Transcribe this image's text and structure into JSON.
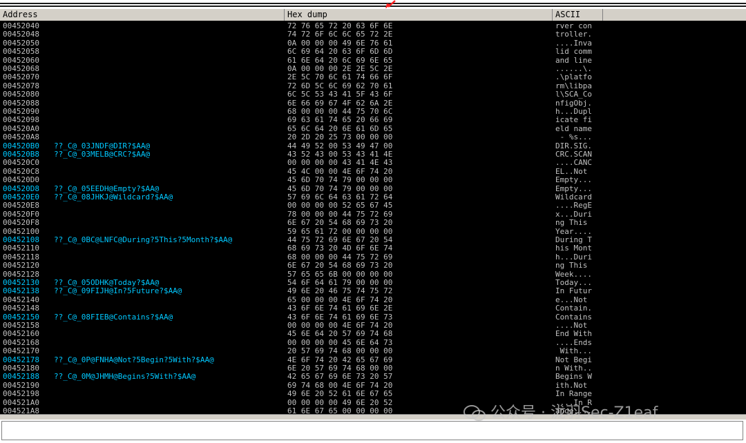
{
  "header": {
    "address": "Address",
    "hex_dump": "Hex dump",
    "ascii": "ASCII"
  },
  "rows": [
    {
      "addr": "00452040",
      "label": "",
      "hex": "72 76 65 72 20 63 6F 6E",
      "ascii": "rver con"
    },
    {
      "addr": "00452048",
      "label": "",
      "hex": "74 72 6F 6C 6C 65 72 2E",
      "ascii": "troller."
    },
    {
      "addr": "00452050",
      "label": "",
      "hex": "0A 00 00 00 49 6E 76 61",
      "ascii": "....Inva"
    },
    {
      "addr": "00452058",
      "label": "",
      "hex": "6C 69 64 20 63 6F 6D 6D",
      "ascii": "lid comm"
    },
    {
      "addr": "00452060",
      "label": "",
      "hex": "61 6E 64 20 6C 69 6E 65",
      "ascii": "and line"
    },
    {
      "addr": "00452068",
      "label": "",
      "hex": "0A 00 00 00 2E 2E 5C 2E",
      "ascii": "......\\."
    },
    {
      "addr": "00452070",
      "label": "",
      "hex": "2E 5C 70 6C 61 74 66 6F",
      "ascii": ".\\platfo"
    },
    {
      "addr": "00452078",
      "label": "",
      "hex": "72 6D 5C 6C 69 62 70 61",
      "ascii": "rm\\libpa"
    },
    {
      "addr": "00452080",
      "label": "",
      "hex": "6C 5C 53 43 41 5F 43 6F",
      "ascii": "l\\SCA_Co"
    },
    {
      "addr": "00452088",
      "label": "",
      "hex": "6E 66 69 67 4F 62 6A 2E",
      "ascii": "nfigObj."
    },
    {
      "addr": "00452090",
      "label": "",
      "hex": "68 00 00 00 44 75 70 6C",
      "ascii": "h...Dupl"
    },
    {
      "addr": "00452098",
      "label": "",
      "hex": "69 63 61 74 65 20 66 69",
      "ascii": "icate fi"
    },
    {
      "addr": "004520A0",
      "label": "",
      "hex": "65 6C 64 20 6E 61 6D 65",
      "ascii": "eld name"
    },
    {
      "addr": "004520A8",
      "label": "",
      "hex": "20 2D 20 25 73 00 00 00",
      "ascii": " - %s..."
    },
    {
      "addr": "004520B0",
      "label": "??_C@_03JNDF@DIR?$AA@",
      "hex": "44 49 52 00 53 49 47 00",
      "ascii": "DIR.SIG."
    },
    {
      "addr": "004520B8",
      "label": "??_C@_03MELB@CRC?$AA@",
      "hex": "43 52 43 00 53 43 41 4E",
      "ascii": "CRC.SCAN"
    },
    {
      "addr": "004520C0",
      "label": "",
      "hex": "00 00 00 00 43 41 4E 43",
      "ascii": "....CANC"
    },
    {
      "addr": "004520C8",
      "label": "",
      "hex": "45 4C 00 00 4E 6F 74 20",
      "ascii": "EL..Not "
    },
    {
      "addr": "004520D0",
      "label": "",
      "hex": "45 6D 70 74 79 00 00 00",
      "ascii": "Empty..."
    },
    {
      "addr": "004520D8",
      "label": "??_C@_05EEDH@Empty?$AA@",
      "hex": "45 6D 70 74 79 00 00 00",
      "ascii": "Empty..."
    },
    {
      "addr": "004520E0",
      "label": "??_C@_08JHKJ@Wildcard?$AA@",
      "hex": "57 69 6C 64 63 61 72 64",
      "ascii": "Wildcard"
    },
    {
      "addr": "004520E8",
      "label": "",
      "hex": "00 00 00 00 52 65 67 45",
      "ascii": "....RegE"
    },
    {
      "addr": "004520F0",
      "label": "",
      "hex": "78 00 00 00 44 75 72 69",
      "ascii": "x...Duri"
    },
    {
      "addr": "004520F8",
      "label": "",
      "hex": "6E 67 20 54 68 69 73 20",
      "ascii": "ng This "
    },
    {
      "addr": "00452100",
      "label": "",
      "hex": "59 65 61 72 00 00 00 00",
      "ascii": "Year...."
    },
    {
      "addr": "00452108",
      "label": "??_C@_0BC@LNFC@During?5This?5Month?$AA@",
      "hex": "44 75 72 69 6E 67 20 54",
      "ascii": "During T"
    },
    {
      "addr": "00452110",
      "label": "",
      "hex": "68 69 73 20 4D 6F 6E 74",
      "ascii": "his Mont"
    },
    {
      "addr": "00452118",
      "label": "",
      "hex": "68 00 00 00 44 75 72 69",
      "ascii": "h...Duri"
    },
    {
      "addr": "00452120",
      "label": "",
      "hex": "6E 67 20 54 68 69 73 20",
      "ascii": "ng This "
    },
    {
      "addr": "00452128",
      "label": "",
      "hex": "57 65 65 6B 00 00 00 00",
      "ascii": "Week...."
    },
    {
      "addr": "00452130",
      "label": "??_C@_05ODHK@Today?$AA@",
      "hex": "54 6F 64 61 79 00 00 00",
      "ascii": "Today..."
    },
    {
      "addr": "00452138",
      "label": "??_C@_09FIJH@In?5Future?$AA@",
      "hex": "49 6E 20 46 75 74 75 72",
      "ascii": "In Futur"
    },
    {
      "addr": "00452140",
      "label": "",
      "hex": "65 00 00 00 4E 6F 74 20",
      "ascii": "e...Not "
    },
    {
      "addr": "00452148",
      "label": "",
      "hex": "43 6F 6E 74 61 69 6E 2E",
      "ascii": "Contain."
    },
    {
      "addr": "00452150",
      "label": "??_C@_08FIEB@Contains?$AA@",
      "hex": "43 6F 6E 74 61 69 6E 73",
      "ascii": "Contains"
    },
    {
      "addr": "00452158",
      "label": "",
      "hex": "00 00 00 00 4E 6F 74 20",
      "ascii": "....Not "
    },
    {
      "addr": "00452160",
      "label": "",
      "hex": "45 6E 64 20 57 69 74 68",
      "ascii": "End With"
    },
    {
      "addr": "00452168",
      "label": "",
      "hex": "00 00 00 00 45 6E 64 73",
      "ascii": "....Ends"
    },
    {
      "addr": "00452170",
      "label": "",
      "hex": "20 57 69 74 68 00 00 00",
      "ascii": " With..."
    },
    {
      "addr": "00452178",
      "label": "??_C@_0P@FNHA@Not?5Begin?5With?$AA@",
      "hex": "4E 6F 74 20 42 65 67 69",
      "ascii": "Not Begi"
    },
    {
      "addr": "00452180",
      "label": "",
      "hex": "6E 20 57 69 74 68 00 00",
      "ascii": "n With.."
    },
    {
      "addr": "00452188",
      "label": "??_C@_0M@JHMH@Begins?5With?$AA@",
      "hex": "42 65 67 69 6E 73 20 57",
      "ascii": "Begins W"
    },
    {
      "addr": "00452190",
      "label": "",
      "hex": "69 74 68 00 4E 6F 74 20",
      "ascii": "ith.Not "
    },
    {
      "addr": "00452198",
      "label": "",
      "hex": "49 6E 20 52 61 6E 67 65",
      "ascii": "In Range"
    },
    {
      "addr": "004521A0",
      "label": "",
      "hex": "00 00 00 00 49 6E 20 52",
      "ascii": "....In R"
    },
    {
      "addr": "004521A8",
      "label": "",
      "hex": "61 6E 67 65 00 00 00 00",
      "ascii": "ange...."
    }
  ],
  "watermark": "公众号 · 泷羽Sec-Z1eaf",
  "colors": {
    "background": "#000000",
    "text": "#c0c0c0",
    "label": "#00c8ff",
    "header_bg": "#d4d0c8",
    "arrow": "#ff2020"
  }
}
